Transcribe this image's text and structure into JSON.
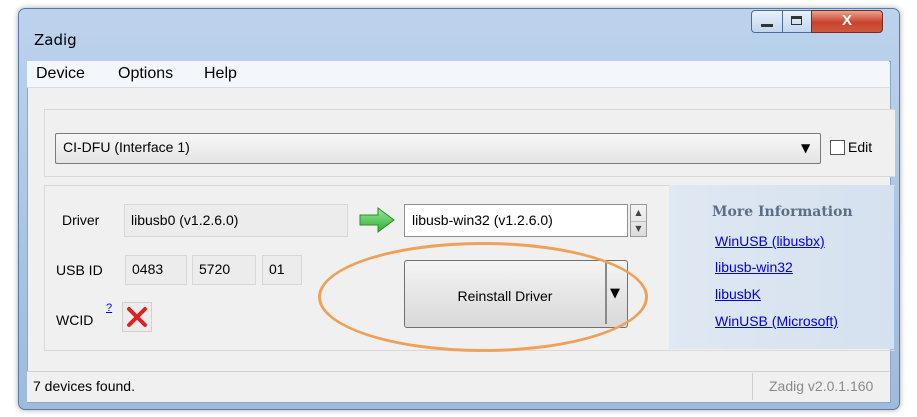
{
  "window": {
    "title": "Zadig"
  },
  "menu": {
    "items": [
      "Device",
      "Options",
      "Help"
    ]
  },
  "device": {
    "selected": "CI-DFU (Interface 1)",
    "edit_label": "Edit"
  },
  "driver": {
    "label": "Driver",
    "current": "libusb0 (v1.2.6.0)",
    "target": "libusb-win32 (v1.2.6.0)"
  },
  "usb": {
    "label": "USB ID",
    "vid": "0483",
    "pid": "5720",
    "mi": "01"
  },
  "wcid": {
    "label": "WCID",
    "superscript": "?"
  },
  "action": {
    "label": "Reinstall Driver"
  },
  "info": {
    "title": "More Information",
    "links": [
      "WinUSB (libusbx)",
      "libusb-win32",
      "libusbK",
      "WinUSB (Microsoft)"
    ]
  },
  "status": {
    "message": "7 devices found.",
    "version": "Zadig v2.0.1.160"
  },
  "colors": {
    "arrow": "#3cc43c",
    "wcid_x": "#e02020",
    "highlight": "#f0a057",
    "link": "#0000ee"
  }
}
